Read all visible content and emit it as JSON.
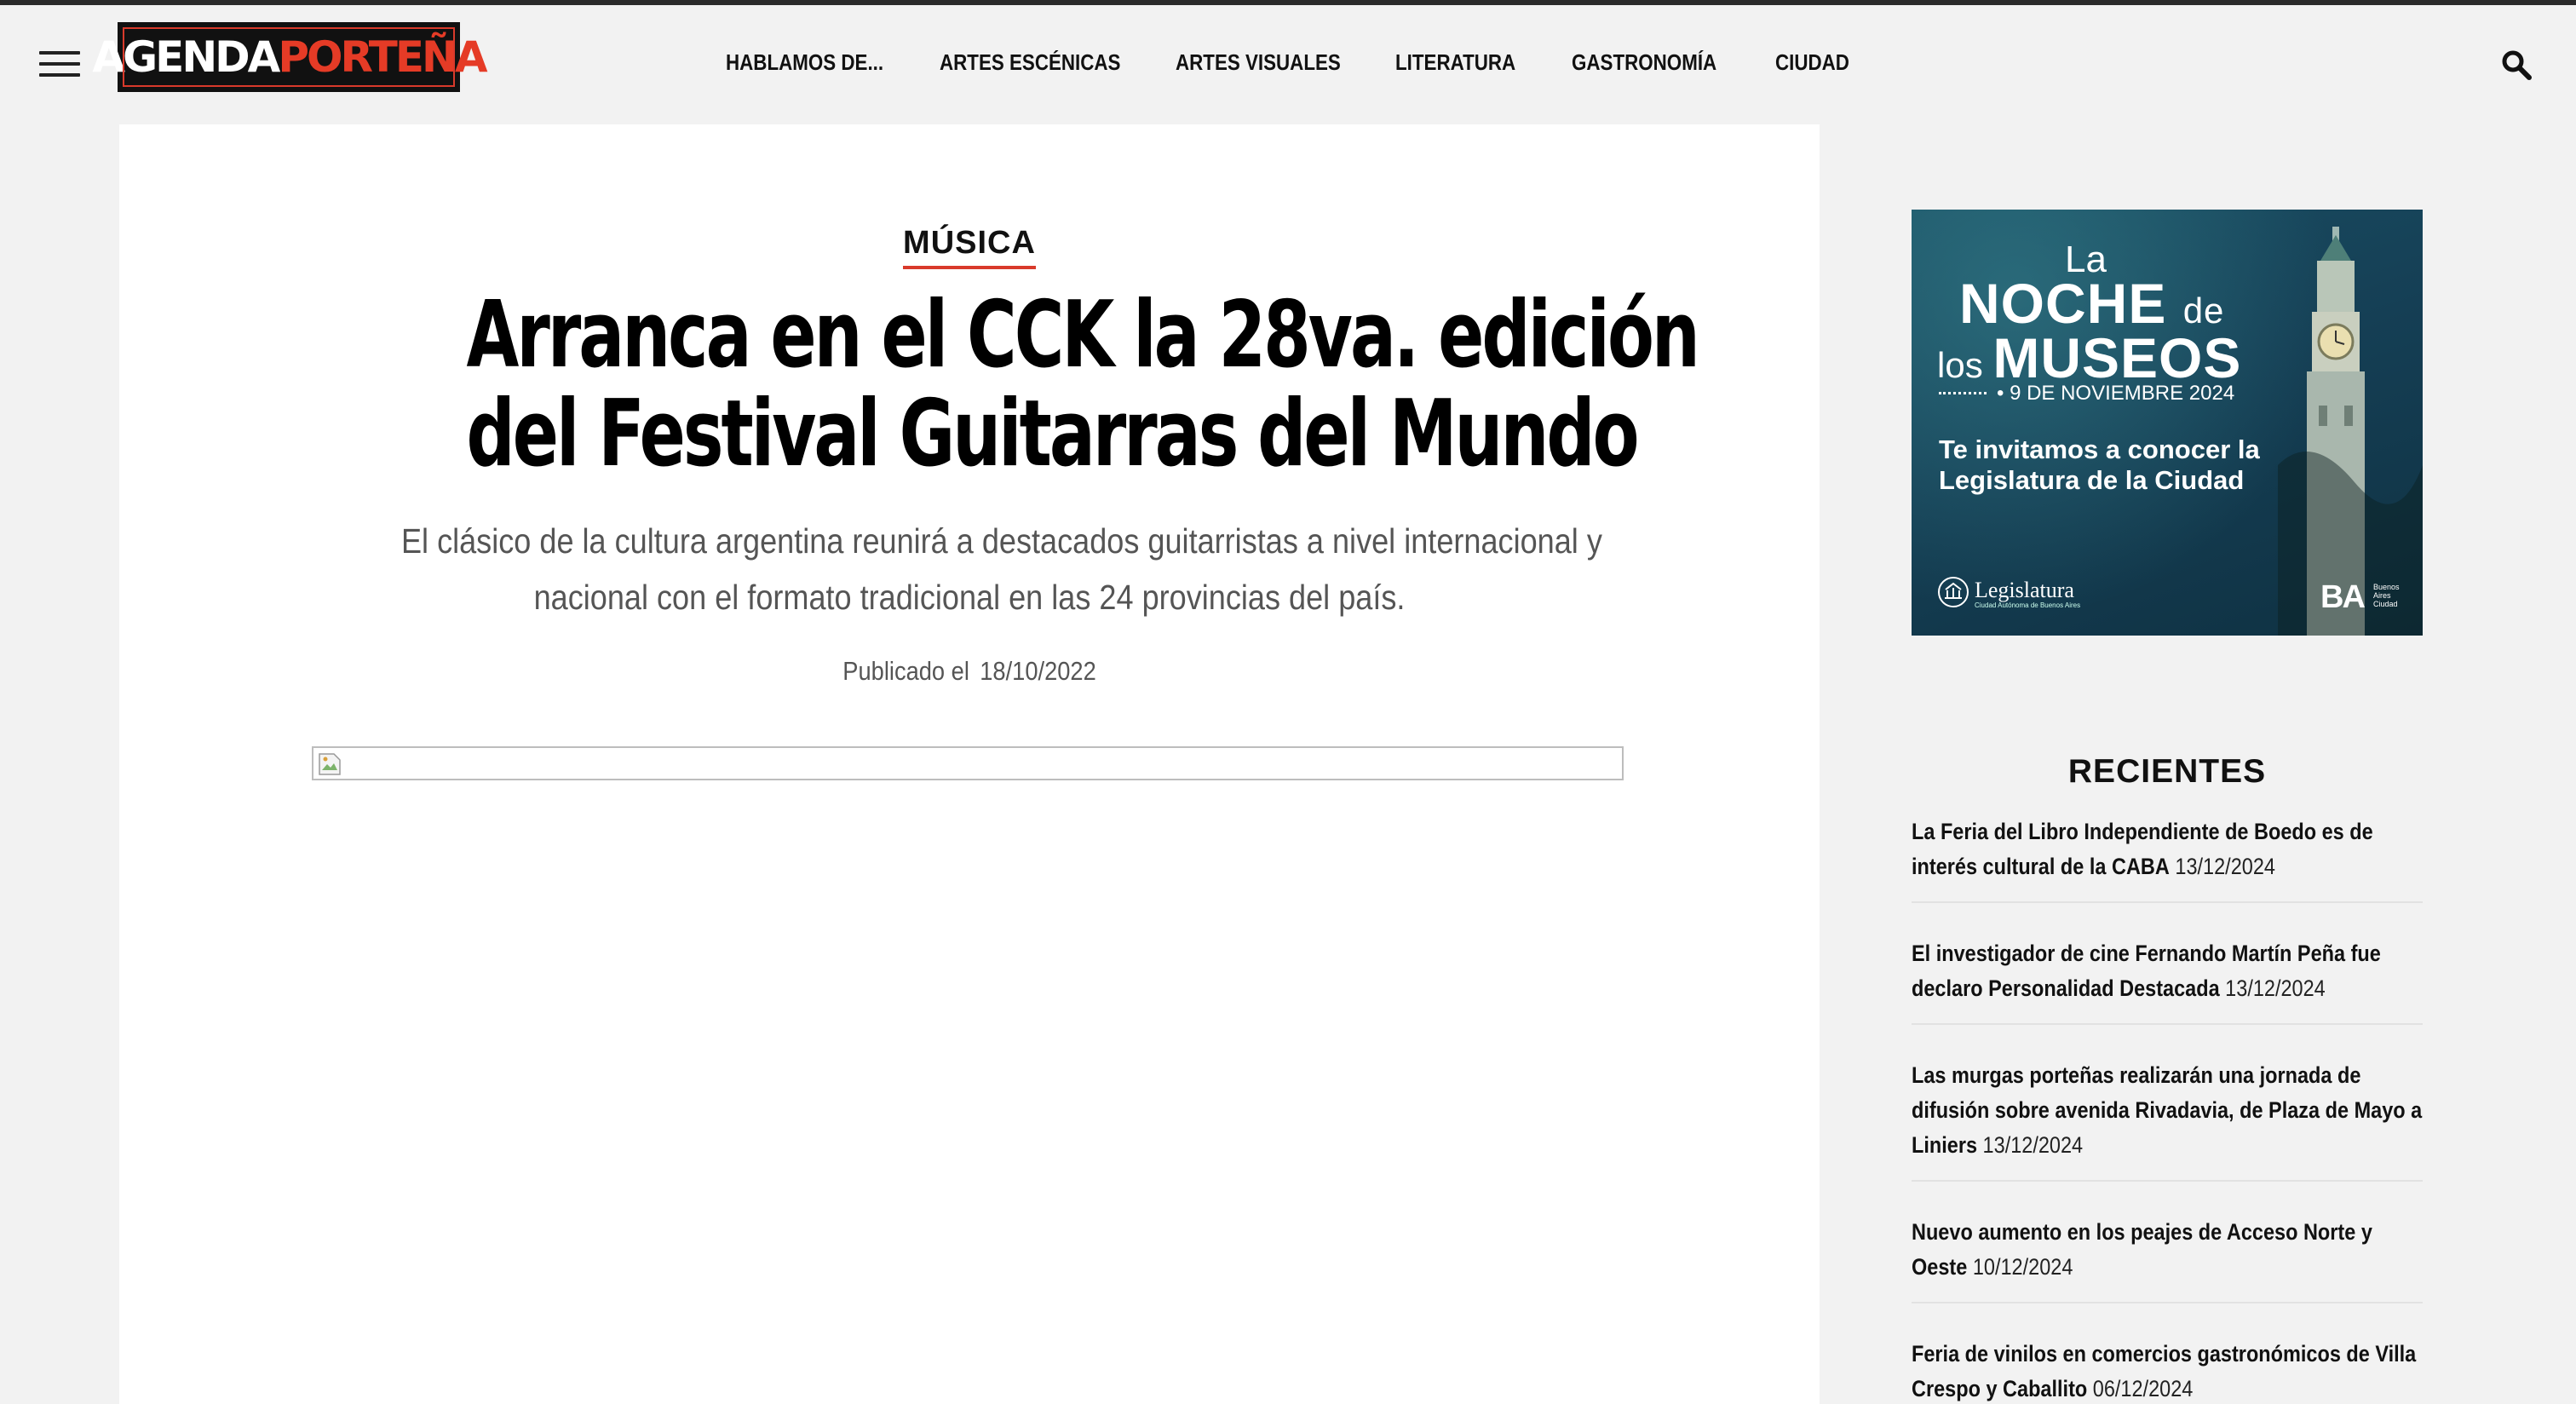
{
  "header": {
    "logo_part1": "AGENDA",
    "logo_part2": "PORTEÑA",
    "nav": [
      {
        "label": "HABLAMOS DE..."
      },
      {
        "label": "ARTES ESCÉNICAS"
      },
      {
        "label": "ARTES VISUALES"
      },
      {
        "label": "LITERATURA"
      },
      {
        "label": "GASTRONOMÍA"
      },
      {
        "label": "CIUDAD"
      }
    ]
  },
  "article": {
    "category": "MÚSICA",
    "title_line1": "Arranca en el CCK la 28va. edición",
    "title_line2": "del Festival Guitarras del Mundo",
    "subtitle_line1": "El clásico de la cultura argentina reunirá a destacados guitarristas a nivel internacional y",
    "subtitle_line2": "nacional con el formato tradicional en las 24 provincias del país.",
    "published_label": "Publicado el",
    "published_date": "18/10/2022"
  },
  "ad": {
    "la": "La",
    "noche": "NOCHE",
    "de": "de",
    "los": "los",
    "museos": "MUSEOS",
    "fecha": "• 9 DE NOVIEMBRE 2024",
    "invite": "Te invitamos a conocer la Legislatura de la Ciudad",
    "legislatura": "Legislatura",
    "legislatura_sub": "Ciudad Autónoma de Buenos Aires",
    "ba": "BA",
    "ba_sub": "Buenos Aires Ciudad"
  },
  "recientes": {
    "title": "RECIENTES",
    "items": [
      {
        "title": "La Feria del Libro Independiente de Boedo es de interés cultural de la CABA",
        "date": "13/12/2024"
      },
      {
        "title": "El investigador de cine Fernando Martín Peña fue declaro Personalidad Destacada",
        "date": "13/12/2024"
      },
      {
        "title": "Las murgas porteñas realizarán una jornada de difusión sobre avenida Rivadavia, de Plaza de Mayo a Liniers",
        "date": "13/12/2024"
      },
      {
        "title": "Nuevo aumento en los peajes de Acceso Norte y Oeste",
        "date": "10/12/2024"
      },
      {
        "title": "Feria de vinilos en comercios gastronómicos de Villa Crespo y Caballito",
        "date": "06/12/2024"
      }
    ]
  },
  "colors": {
    "accent": "#d93a2b",
    "background": "#f2f2f2",
    "card": "#ffffff"
  }
}
